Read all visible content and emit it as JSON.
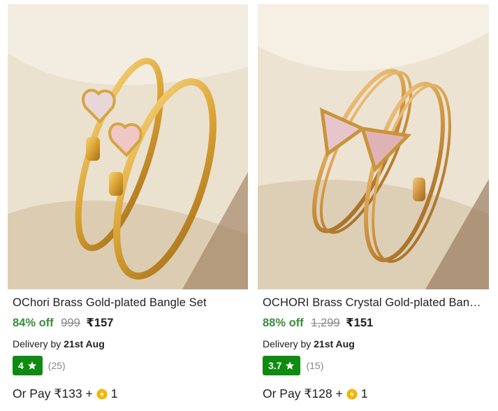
{
  "products": [
    {
      "image_alt": "heart bangle set",
      "title": "OChori Brass Gold-plated Bangle Set",
      "discount": "84% off",
      "mrp": "999",
      "price": "₹157",
      "delivery_prefix": "Delivery by",
      "delivery_date": "21st Aug",
      "rating": "4",
      "rating_count": "(25)",
      "pay_prefix": "Or Pay ₹133 +",
      "coins": "1"
    },
    {
      "image_alt": "triangle bangle set",
      "title": "OCHORI Brass Crystal Gold-plated Bangle Set",
      "discount": "88% off",
      "mrp": "1,299",
      "price": "₹151",
      "delivery_prefix": "Delivery by",
      "delivery_date": "21st Aug",
      "rating": "3.7",
      "rating_count": "(15)",
      "pay_prefix": "Or Pay ₹128 +",
      "coins": "1"
    }
  ],
  "colors": {
    "discount": "#388e3c",
    "rating_badge": "#0f8a12",
    "muted": "#878787",
    "coin": "#f5b400"
  },
  "icons": [
    "star-icon",
    "supercoin-icon"
  ]
}
